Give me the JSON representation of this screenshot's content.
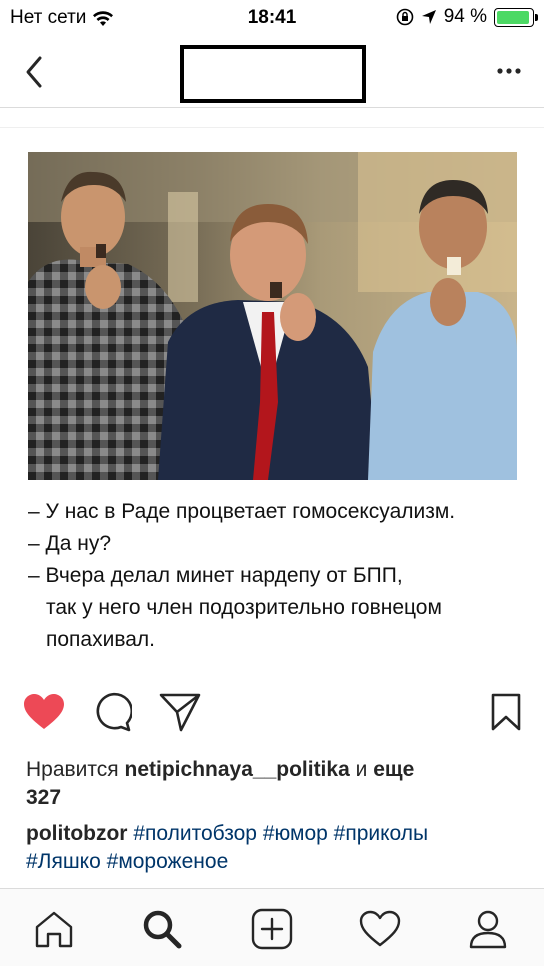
{
  "status_bar": {
    "carrier": "Нет сети",
    "time": "18:41",
    "battery_percent": "94 %",
    "battery_level": 0.94,
    "icons": [
      "wifi-icon",
      "orientation-lock-icon",
      "location-icon",
      "battery-icon"
    ]
  },
  "nav": {
    "back_icon": "chevron-left-icon",
    "more_icon": "more-horizontal-icon"
  },
  "post": {
    "image_text": [
      "– У нас в Раде процветает гомосексуализм.",
      "– Да ну?",
      "– Вчера делал минет нардепу от БПП,",
      "так у него член подозрительно говнецом",
      "попахивал."
    ],
    "liked": true,
    "likes": {
      "prefix": "Нравится",
      "user": "netipichnaya__politika",
      "middle": "и",
      "more": "еще",
      "count": "327"
    },
    "caption": {
      "author": "politobzor",
      "hashtags": [
        "#политобзор",
        "#юмор",
        "#приколы",
        "#Ляшко",
        "#мороженое"
      ]
    }
  },
  "tabs": [
    "home-icon",
    "search-icon",
    "add-post-icon",
    "activity-heart-icon",
    "profile-icon"
  ],
  "colors": {
    "like": "#ed4956",
    "hashtag": "#003569",
    "battery": "#4cd964"
  }
}
